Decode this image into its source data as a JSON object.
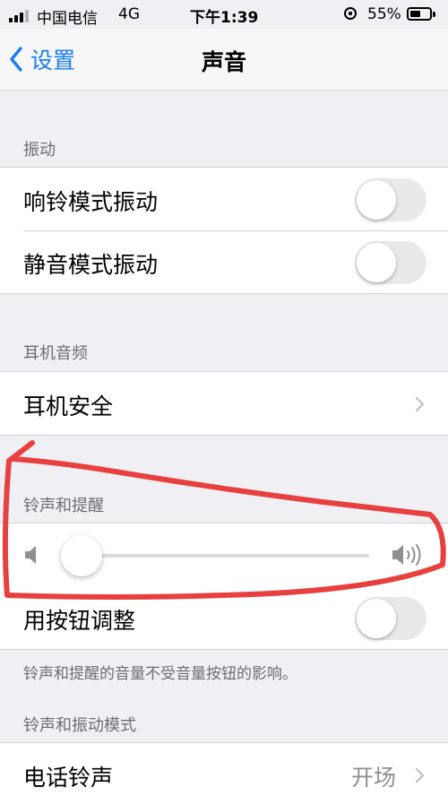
{
  "status_bar": {
    "carrier": "中国电信",
    "network": "4G",
    "time": "下午1:39",
    "battery_percent": "55%",
    "battery_level": 0.55
  },
  "nav": {
    "back_label": "设置",
    "title": "声音"
  },
  "sections": {
    "vibration": {
      "header": "振动",
      "ring_vibrate": {
        "label": "响铃模式振动",
        "on": false
      },
      "silent_vibrate": {
        "label": "静音模式振动",
        "on": false
      }
    },
    "headphone": {
      "header": "耳机音频",
      "safety": {
        "label": "耳机安全"
      }
    },
    "ringer": {
      "header": "铃声和提醒",
      "volume_level": 0.0,
      "change_with_buttons": {
        "label": "用按钮调整",
        "on": false
      },
      "footer": "铃声和提醒的音量不受音量按钮的影响。"
    },
    "sounds": {
      "header": "铃声和振动模式",
      "ringtone": {
        "label": "电话铃声",
        "value": "开场"
      }
    }
  },
  "colors": {
    "accent": "#1a7cf5",
    "annotation": "#e8403f",
    "background": "#efeff4"
  }
}
